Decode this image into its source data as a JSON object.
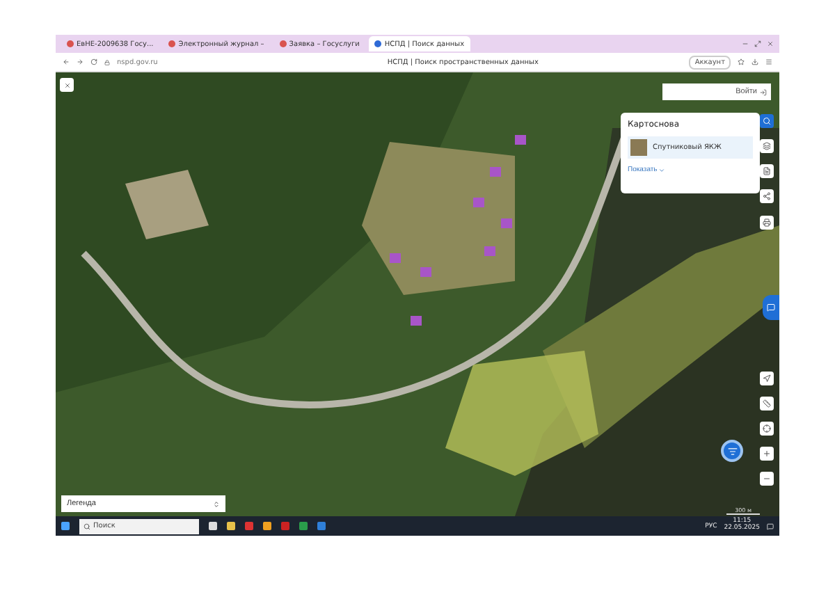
{
  "browser": {
    "tabs": [
      {
        "title": "ЕвНЕ-2009638 Госу...",
        "selected": false
      },
      {
        "title": "Электронный журнал –",
        "selected": false
      },
      {
        "title": "Заявка – Госуслуги",
        "selected": false
      },
      {
        "title": "НСПД | Поиск данных",
        "selected": true
      }
    ],
    "address": "nspd.gov.ru",
    "page_title": "НСПД | Поиск пространственных данных",
    "account": "Аккаунт"
  },
  "map": {
    "login": "Войти",
    "card": {
      "title": "Картоснова",
      "layer": "Спутниковый ЯКЖ",
      "more": "Показать"
    },
    "legend": "Легенда",
    "scale": "300 м"
  },
  "taskbar": {
    "search": "Поиск",
    "lang": "РУС",
    "time": "11:15",
    "date": "22.05.2025"
  }
}
